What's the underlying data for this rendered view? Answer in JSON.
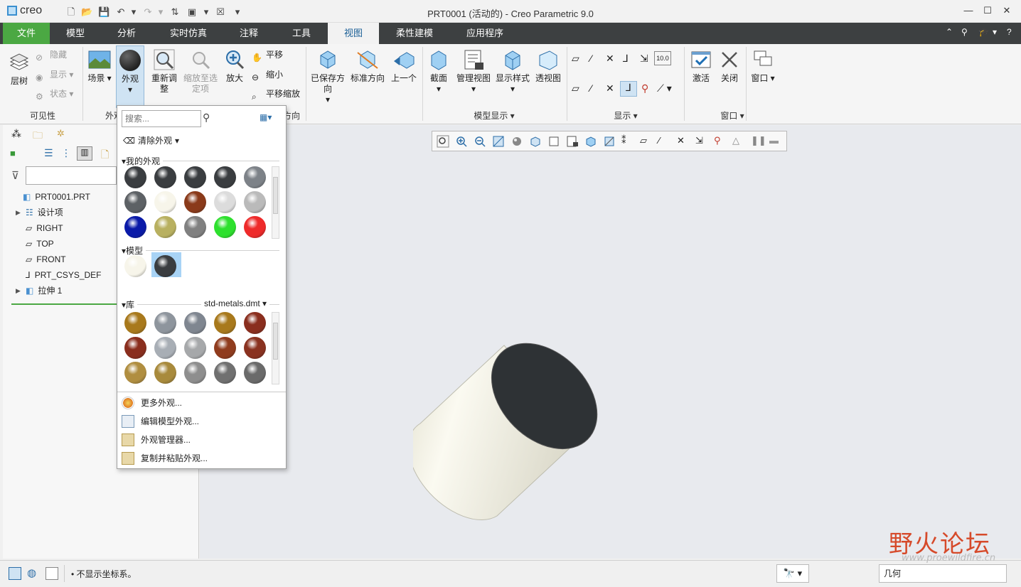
{
  "app": {
    "logo_text": "creo",
    "window_title": "PRT0001 (活动的) - Creo Parametric 9.0"
  },
  "colors": {
    "accent_green": "#4ba843",
    "menubar": "#3d4041",
    "selection_blue": "#a8d3f5",
    "cylinder_body": "#efeee2",
    "cylinder_cap": "#2e3235",
    "watermark": "#d64a2a"
  },
  "menu": {
    "tabs": [
      "文件",
      "模型",
      "分析",
      "实时仿真",
      "注释",
      "工具",
      "视图",
      "柔性建模",
      "应用程序"
    ],
    "active": "视图"
  },
  "ribbon": {
    "visibility": {
      "label": "可见性",
      "layer_tree": "层树",
      "hide": "隐藏",
      "show": "显示",
      "status": "状态"
    },
    "appearance": {
      "label": "外观",
      "scene": "场景",
      "appearance": "外观"
    },
    "orientation": {
      "label": "方向",
      "refit": "重新调整",
      "zoom_to_selected": "缩放至选定项",
      "zoom_in": "放大",
      "pan": "平移",
      "zoom_out": "缩小",
      "pan_zoom": "平移缩放",
      "saved_orientations": "已保存方向",
      "standard_orientation": "标准方向",
      "previous": "上一个"
    },
    "model_display": {
      "label": "模型显示",
      "section": "截面",
      "manage_views": "管理视图",
      "display_style": "显示样式",
      "perspective": "透视图"
    },
    "display": {
      "label": "显示"
    },
    "window": {
      "label": "窗口",
      "activate": "激活",
      "close": "关闭",
      "windows": "窗口"
    }
  },
  "popup": {
    "search_placeholder": "搜索...",
    "clear_appearance": "清除外观",
    "my_appearances_label": "我的外观",
    "model_label": "模型",
    "library_label": "库",
    "library_file": "std-metals.dmt",
    "my_appearances": [
      "#3a3d40",
      "#3a3d40",
      "#3a3d40",
      "#3a3d40",
      "#7d8288",
      "#5d6165",
      "#f7f5ea",
      "#8a3a1a",
      "#dcdcdc",
      "#bababa",
      "#0a1aa8",
      "#b8b060",
      "#808080",
      "#2ee02e",
      "#ee2a2a"
    ],
    "model_appearances": [
      "#f7f5ea",
      "#3a3d40"
    ],
    "library_appearances": [
      "#a8791c",
      "#8e959d",
      "#7f8690",
      "#a8791c",
      "#8a2e1e",
      "#8a2e1e",
      "#a8aeb5",
      "#a6a8aa",
      "#903c1e",
      "#8a3220",
      "#b08e40",
      "#a88a3c",
      "#8e8e8e",
      "#707070",
      "#6a6a6a"
    ],
    "actions": [
      "更多外观...",
      "编辑模型外观...",
      "外观管理器...",
      "复制并粘贴外观..."
    ]
  },
  "tree": {
    "items": [
      "PRT0001.PRT",
      "设计项",
      "RIGHT",
      "TOP",
      "FRONT",
      "PRT_CSYS_DEF",
      "拉伸 1"
    ]
  },
  "status": {
    "message": "不显示坐标系。",
    "filter": "几何"
  },
  "watermark": {
    "title": "野火论坛",
    "url": "www.proewildfire.cn"
  }
}
